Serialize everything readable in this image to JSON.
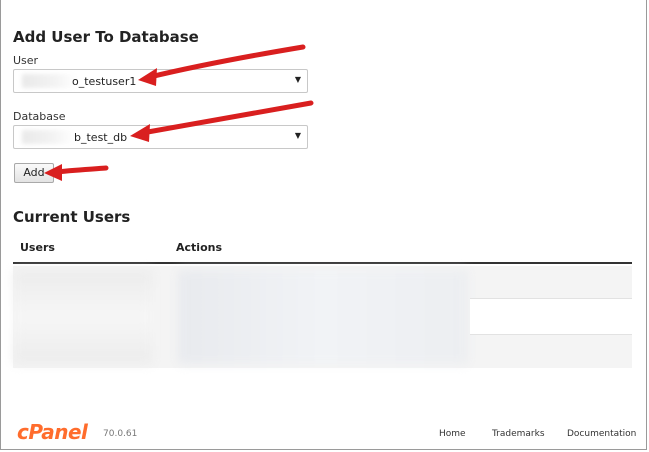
{
  "add_user_section": {
    "title": "Add User To Database",
    "user_label": "User",
    "user_value_suffix": "_testuser1",
    "user_value_prefix_glyph": "o",
    "database_label": "Database",
    "database_value_suffix": "b_test_db",
    "add_button_label": "Add"
  },
  "current_users_section": {
    "title": "Current Users",
    "columns": [
      "Users",
      "Actions"
    ]
  },
  "footer": {
    "logo": "cPanel",
    "version": "70.0.61",
    "links": [
      "Home",
      "Trademarks",
      "Documentation"
    ]
  },
  "colors": {
    "annotation_arrow": "#d91f1f",
    "cpanel_orange": "#ff6c2c"
  }
}
